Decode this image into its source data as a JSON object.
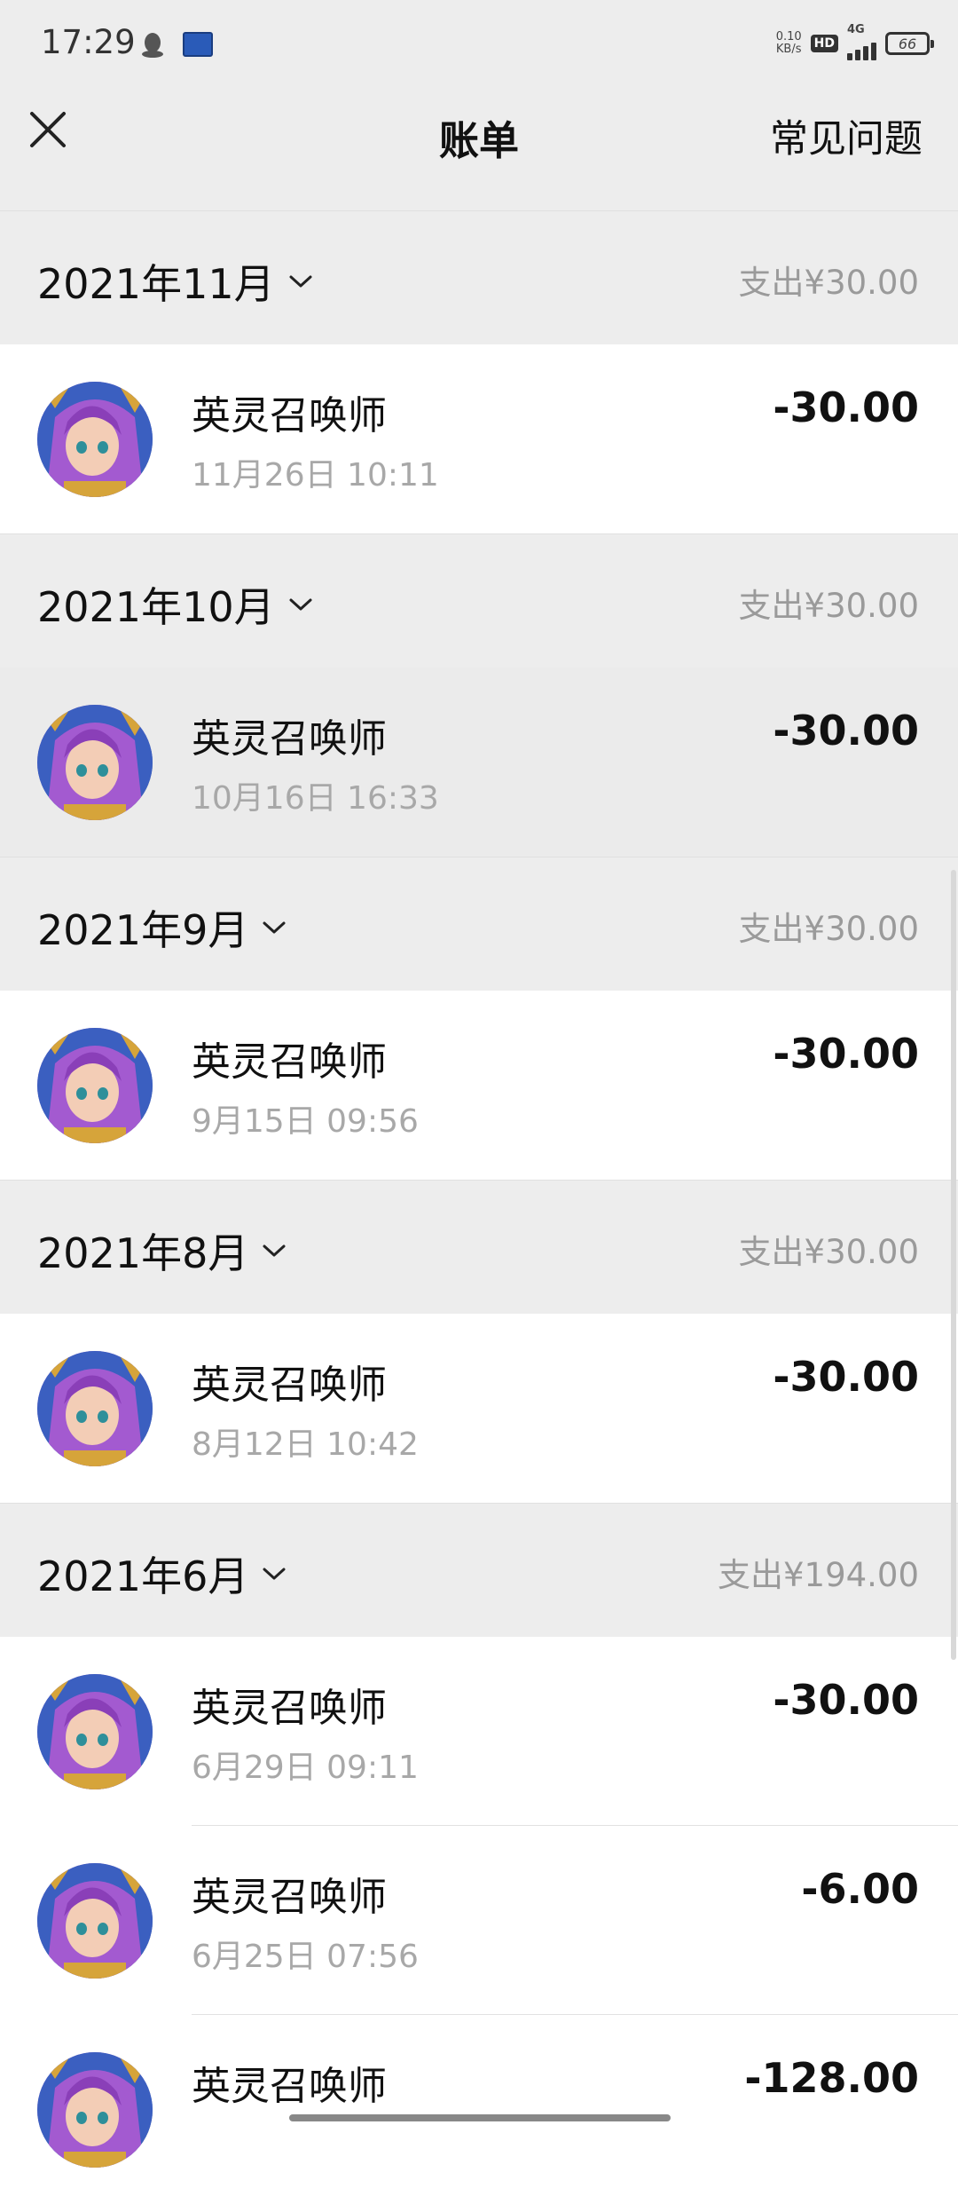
{
  "status_bar": {
    "time": "17:29",
    "net_speed_value": "0.10",
    "net_speed_unit": "KB/s",
    "hd_label": "HD",
    "network_label": "4G",
    "battery_level": "66",
    "icons": [
      "qq-icon",
      "app-notification-icon",
      "hd-icon",
      "signal-icon",
      "battery-icon"
    ]
  },
  "nav": {
    "close_icon": "close-icon",
    "title": "账单",
    "faq_label": "常见问题"
  },
  "months": [
    {
      "label": "2021年11月",
      "summary": "支出¥30.00",
      "transactions": [
        {
          "name": "英灵召唤师",
          "time": "11月26日 10:11",
          "amount": "-30.00"
        }
      ]
    },
    {
      "label": "2021年10月",
      "summary": "支出¥30.00",
      "transactions": [
        {
          "name": "英灵召唤师",
          "time": "10月16日 16:33",
          "amount": "-30.00"
        }
      ]
    },
    {
      "label": "2021年9月",
      "summary": "支出¥30.00",
      "transactions": [
        {
          "name": "英灵召唤师",
          "time": "9月15日 09:56",
          "amount": "-30.00"
        }
      ]
    },
    {
      "label": "2021年8月",
      "summary": "支出¥30.00",
      "transactions": [
        {
          "name": "英灵召唤师",
          "time": "8月12日 10:42",
          "amount": "-30.00"
        }
      ]
    },
    {
      "label": "2021年6月",
      "summary": "支出¥194.00",
      "transactions": [
        {
          "name": "英灵召唤师",
          "time": "6月29日 09:11",
          "amount": "-30.00"
        },
        {
          "name": "英灵召唤师",
          "time": "6月25日 07:56",
          "amount": "-6.00"
        },
        {
          "name": "英灵召唤师",
          "time": "",
          "amount": "-128.00"
        }
      ]
    }
  ],
  "colors": {
    "background": "#ededed",
    "card": "#ffffff",
    "muted_text": "#a8a8a8"
  }
}
